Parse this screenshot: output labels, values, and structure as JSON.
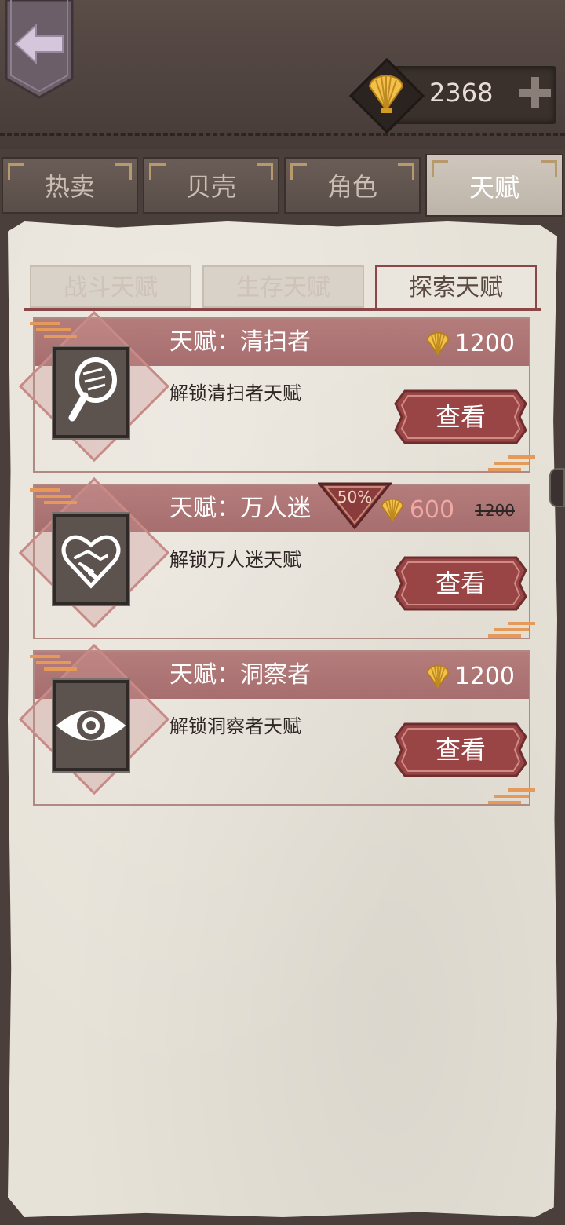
{
  "currency": {
    "amount": "2368",
    "icon": "shell-icon",
    "add_icon": "plus-icon"
  },
  "main_tabs": [
    {
      "label": "热卖",
      "active": false
    },
    {
      "label": "贝壳",
      "active": false
    },
    {
      "label": "角色",
      "active": false
    },
    {
      "label": "天赋",
      "active": true
    }
  ],
  "sub_tabs": [
    {
      "label": "战斗天赋",
      "active": false
    },
    {
      "label": "生存天赋",
      "active": false
    },
    {
      "label": "探索天赋",
      "active": true
    }
  ],
  "talents": [
    {
      "title": "天赋：清扫者",
      "description": "解锁清扫者天赋",
      "price": "1200",
      "icon": "magnifying-glass-icon",
      "button_label": "查看"
    },
    {
      "title": "天赋：万人迷",
      "description": "解锁万人迷天赋",
      "discount": "50%",
      "price": "600",
      "original_price": "1200",
      "icon": "handshake-heart-icon",
      "button_label": "查看"
    },
    {
      "title": "天赋：洞察者",
      "description": "解锁洞察者天赋",
      "price": "1200",
      "icon": "eye-icon",
      "button_label": "查看"
    }
  ],
  "colors": {
    "accent": "#8b4747",
    "header": "#a66e6e",
    "button": "#9a4545",
    "gold": "#e7b43a"
  }
}
